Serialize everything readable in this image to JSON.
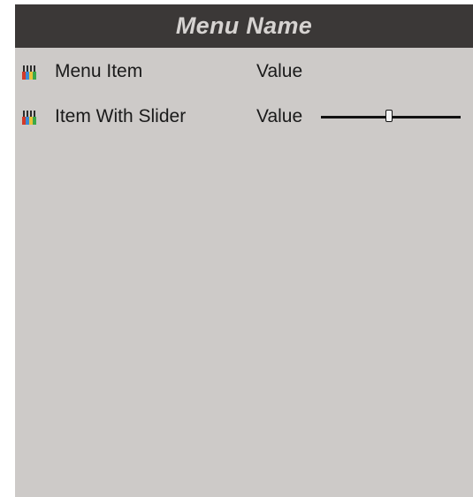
{
  "menu": {
    "title": "Menu Name",
    "items": [
      {
        "icon": "paint-brushes-icon",
        "label": "Menu Item",
        "value": "Value"
      },
      {
        "icon": "paint-brushes-icon",
        "label": "Item With Slider",
        "value": "Value",
        "slider_fraction": 0.49
      }
    ]
  },
  "colors": {
    "panel_background": "#cdcac8",
    "header_background": "#3b3837",
    "header_text": "#d6d3d1"
  }
}
